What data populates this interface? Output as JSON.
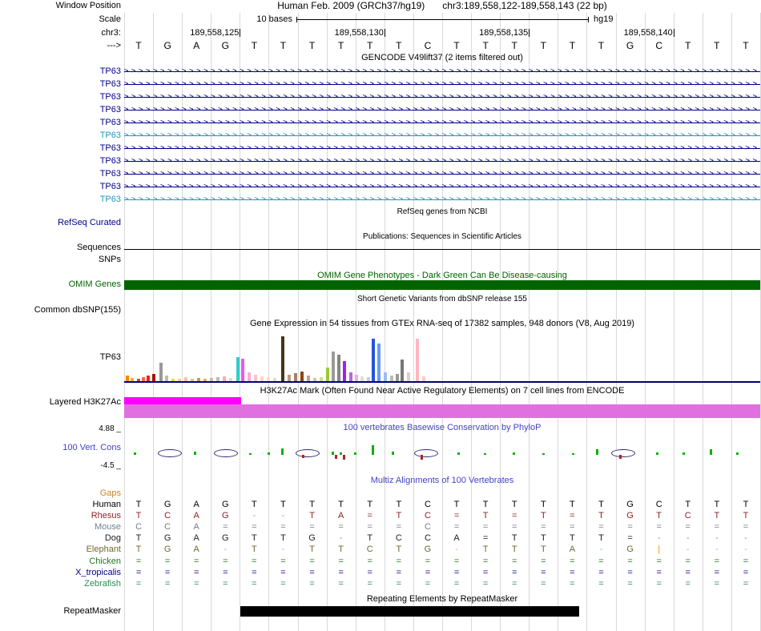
{
  "colors": {
    "track_navy": "#00008b",
    "track_teal": "#2196be",
    "omim_green": "#006400",
    "header_blue": "#4343c8",
    "h3k_orchid": "#e070e0",
    "h3k_magenta": "#ff00ff",
    "gtex_baseline": "#000080",
    "grid_line": "#d9d9d9",
    "gaps_orange": "#c78520"
  },
  "window_position": {
    "label": "Window Position",
    "title": "Human Feb. 2009 (GRCh37/hg19)",
    "range": "chr3:189,558,122-189,558,143 (22 bp)"
  },
  "scale": {
    "label": "Scale",
    "value": "10 bases",
    "assembly": "hg19"
  },
  "ruler": {
    "label": "chr3:",
    "ticks": [
      "189,558,125",
      "189,558,130",
      "189,558,135",
      "189,558,140"
    ],
    "tick_cols": [
      4,
      9,
      14,
      19
    ]
  },
  "sequence": {
    "label": "--->",
    "bases": [
      "T",
      "G",
      "A",
      "G",
      "T",
      "T",
      "T",
      "T",
      "T",
      "T",
      "C",
      "T",
      "T",
      "T",
      "T",
      "T",
      "T",
      "G",
      "C",
      "T",
      "T",
      "T"
    ]
  },
  "gencode": {
    "header": "GENCODE V49lift37 (2 items filtered out)",
    "gene_label": "TP63",
    "arrow_glyph": ">",
    "rows": [
      "dark",
      "dark",
      "dark",
      "dark",
      "dark",
      "light",
      "dark",
      "dark",
      "dark",
      "dark",
      "light"
    ]
  },
  "refseq": {
    "header": "RefSeq genes from NCBI",
    "label": "RefSeq Curated"
  },
  "publications": {
    "header": "Publications: Sequences in Scientific Articles",
    "label": "Sequences"
  },
  "snps": {
    "label": "SNPs"
  },
  "omim": {
    "header": "OMIM Gene Phenotypes - Dark Green Can Be Disease-causing",
    "label": "OMIM Genes"
  },
  "dbsnp": {
    "header": "Short Genetic Variants from dbSNP release 155",
    "label": "Common dbSNP(155)"
  },
  "gtex": {
    "header": "Gene Expression in 54 tissues from GTEx RNA-seq of 17382 samples, 948 donors (V8, Aug 2019)",
    "label": "TP63",
    "bars": [
      [
        157,
        8,
        "#ff8800"
      ],
      [
        163,
        5,
        "#ffaa33"
      ],
      [
        171,
        4,
        "#dd4444"
      ],
      [
        177,
        6,
        "#ff6655"
      ],
      [
        183,
        8,
        "#ee2222"
      ],
      [
        190,
        10,
        "#aa1111"
      ],
      [
        199,
        24,
        "#999999"
      ],
      [
        206,
        8,
        "#bbbbbb"
      ],
      [
        214,
        4,
        "#dddd44"
      ],
      [
        222,
        4,
        "#eecc99"
      ],
      [
        230,
        6,
        "#ffbbbb"
      ],
      [
        238,
        4,
        "#eebb88"
      ],
      [
        246,
        5,
        "#cc9955"
      ],
      [
        254,
        4,
        "#ddaa77"
      ],
      [
        262,
        5,
        "#ccbbaa"
      ],
      [
        270,
        6,
        "#bbbbbb"
      ],
      [
        278,
        7,
        "#ffaaaa"
      ],
      [
        286,
        5,
        "#ffcccc"
      ],
      [
        295,
        31,
        "#33cccc"
      ],
      [
        301,
        29,
        "#ee55ee"
      ],
      [
        309,
        12,
        "#ffaacc"
      ],
      [
        317,
        9,
        "#ffc0cb"
      ],
      [
        325,
        7,
        "#ffd0d8"
      ],
      [
        333,
        6,
        "#eedddd"
      ],
      [
        341,
        5,
        "#e8d8c8"
      ],
      [
        351,
        57,
        "#4a3319"
      ],
      [
        359,
        9,
        "#bb9988"
      ],
      [
        367,
        11,
        "#a08070"
      ],
      [
        375,
        13,
        "#8b4513"
      ],
      [
        383,
        8,
        "#cc9999"
      ],
      [
        391,
        5,
        "#ddbbbb"
      ],
      [
        399,
        6,
        "#ccdd99"
      ],
      [
        407,
        18,
        "#99cc33"
      ],
      [
        414,
        38,
        "#9a9a9a"
      ],
      [
        421,
        34,
        "#858585"
      ],
      [
        428,
        26,
        "#a020f0"
      ],
      [
        436,
        12,
        "#bb66dd"
      ],
      [
        443,
        9,
        "#eeaaee"
      ],
      [
        450,
        7,
        "#dddddd"
      ],
      [
        458,
        6,
        "#cccccc"
      ],
      [
        464,
        54,
        "#2255dd"
      ],
      [
        471,
        48,
        "#6699ff"
      ],
      [
        479,
        12,
        "#99bbff"
      ],
      [
        487,
        8,
        "#bbbbbb"
      ],
      [
        494,
        10,
        "#999999"
      ],
      [
        500,
        28,
        "#777777"
      ],
      [
        508,
        12,
        "#e8c8c8"
      ],
      [
        519,
        54,
        "#ffb6c1"
      ],
      [
        527,
        7,
        "#ffc8d0"
      ]
    ]
  },
  "h3k27ac": {
    "header": "H3K27Ac Mark (Often Found Near Active Regulatory Elements) on 7 cell lines from ENCODE",
    "label": "Layered H3K27Ac"
  },
  "phylop": {
    "header": "100 vertebrates Basewise Conservation by PhyloP",
    "label": "100 Vert. Cons",
    "max_label": "4.88 _",
    "min_label": "-4.5 _",
    "marks": [
      [
        168,
        "g",
        3
      ],
      [
        211,
        "e",
        0
      ],
      [
        243,
        "g",
        4
      ],
      [
        281,
        "e",
        0
      ],
      [
        312,
        "g",
        2
      ],
      [
        335,
        "g",
        3
      ],
      [
        352,
        "g",
        8
      ],
      [
        383,
        "e",
        0
      ],
      [
        378,
        "r",
        4
      ],
      [
        415,
        "g",
        4
      ],
      [
        419,
        "r",
        5
      ],
      [
        425,
        "g",
        3
      ],
      [
        429,
        "r",
        6
      ],
      [
        443,
        "g",
        3
      ],
      [
        465,
        "g",
        12
      ],
      [
        490,
        "g",
        4
      ],
      [
        531,
        "e",
        0
      ],
      [
        526,
        "r",
        6
      ],
      [
        572,
        "g",
        3
      ],
      [
        605,
        "g",
        2
      ],
      [
        641,
        "g",
        3
      ],
      [
        678,
        "g",
        2
      ],
      [
        715,
        "g",
        2
      ],
      [
        745,
        "g",
        7
      ],
      [
        777,
        "e",
        0
      ],
      [
        774,
        "r",
        5
      ],
      [
        820,
        "g",
        3
      ],
      [
        853,
        "g",
        3
      ],
      [
        887,
        "g",
        7
      ],
      [
        920,
        "g",
        3
      ]
    ]
  },
  "multiz": {
    "header": "Multiz Alignments of 100 Vertebrates",
    "gaps_label": "Gaps",
    "species": [
      {
        "name": "Human",
        "color": "#000000",
        "letters": [
          "T",
          "G",
          "A",
          "G",
          "T",
          "T",
          "T",
          "T",
          "T",
          "T",
          "C",
          "T",
          "T",
          "T",
          "T",
          "T",
          "T",
          "G",
          "C",
          "T",
          "T",
          "T"
        ]
      },
      {
        "name": "Rhesus",
        "color": "#8b2323",
        "letters": [
          "T",
          "C",
          "A",
          "G",
          "-",
          "-",
          "T",
          "A",
          "=",
          "T",
          "C",
          "=",
          "T",
          "=",
          "T",
          "=",
          "T",
          "G",
          "T",
          "C",
          "T",
          "T"
        ]
      },
      {
        "name": "Mouse",
        "color": "#708090",
        "letters": [
          "C",
          "C",
          "A",
          "=",
          "=",
          "=",
          "=",
          "=",
          "=",
          "=",
          "C",
          "=",
          "=",
          "=",
          "=",
          "=",
          "=",
          "=",
          "=",
          "=",
          "=",
          "="
        ]
      },
      {
        "name": "Dog",
        "color": "#222222",
        "letters": [
          "T",
          "G",
          "A",
          "G",
          "T",
          "T",
          "G",
          "-",
          "T",
          "C",
          "C",
          "A",
          "=",
          "T",
          "T",
          "T",
          "T",
          "=",
          "-",
          "-",
          "-",
          "-"
        ]
      },
      {
        "name": "Elephant",
        "color": "#6b6b2e",
        "letters": [
          "T",
          "G",
          "A",
          "-",
          "T",
          "-",
          "T",
          "T",
          "C",
          "T",
          "G",
          "-",
          "T",
          "T",
          "T",
          "A",
          "-",
          "G",
          "|",
          "-",
          "-",
          "-"
        ]
      },
      {
        "name": "Chicken",
        "color": "#1e7a1e",
        "letters": [
          "=",
          "=",
          "=",
          "=",
          "=",
          "=",
          "=",
          "=",
          "=",
          "=",
          "=",
          "=",
          "=",
          "=",
          "=",
          "=",
          "=",
          "=",
          "=",
          "=",
          "=",
          "="
        ]
      },
      {
        "name": "X_tropicalis",
        "color": "#00008b",
        "letters": [
          "=",
          "=",
          "=",
          "=",
          "=",
          "=",
          "=",
          "=",
          "=",
          "=",
          "=",
          "=",
          "=",
          "=",
          "=",
          "=",
          "=",
          "=",
          "=",
          "=",
          "=",
          "="
        ]
      },
      {
        "name": "Zebrafish",
        "color": "#2e8b57",
        "letters": [
          "=",
          "=",
          "=",
          "=",
          "=",
          "=",
          "=",
          "=",
          "=",
          "=",
          "=",
          "=",
          "=",
          "=",
          "=",
          "=",
          "=",
          "=",
          "=",
          "=",
          "=",
          "="
        ]
      }
    ]
  },
  "repeatmasker": {
    "header": "Repeating Elements by RepeatMasker",
    "label": "RepeatMasker"
  }
}
